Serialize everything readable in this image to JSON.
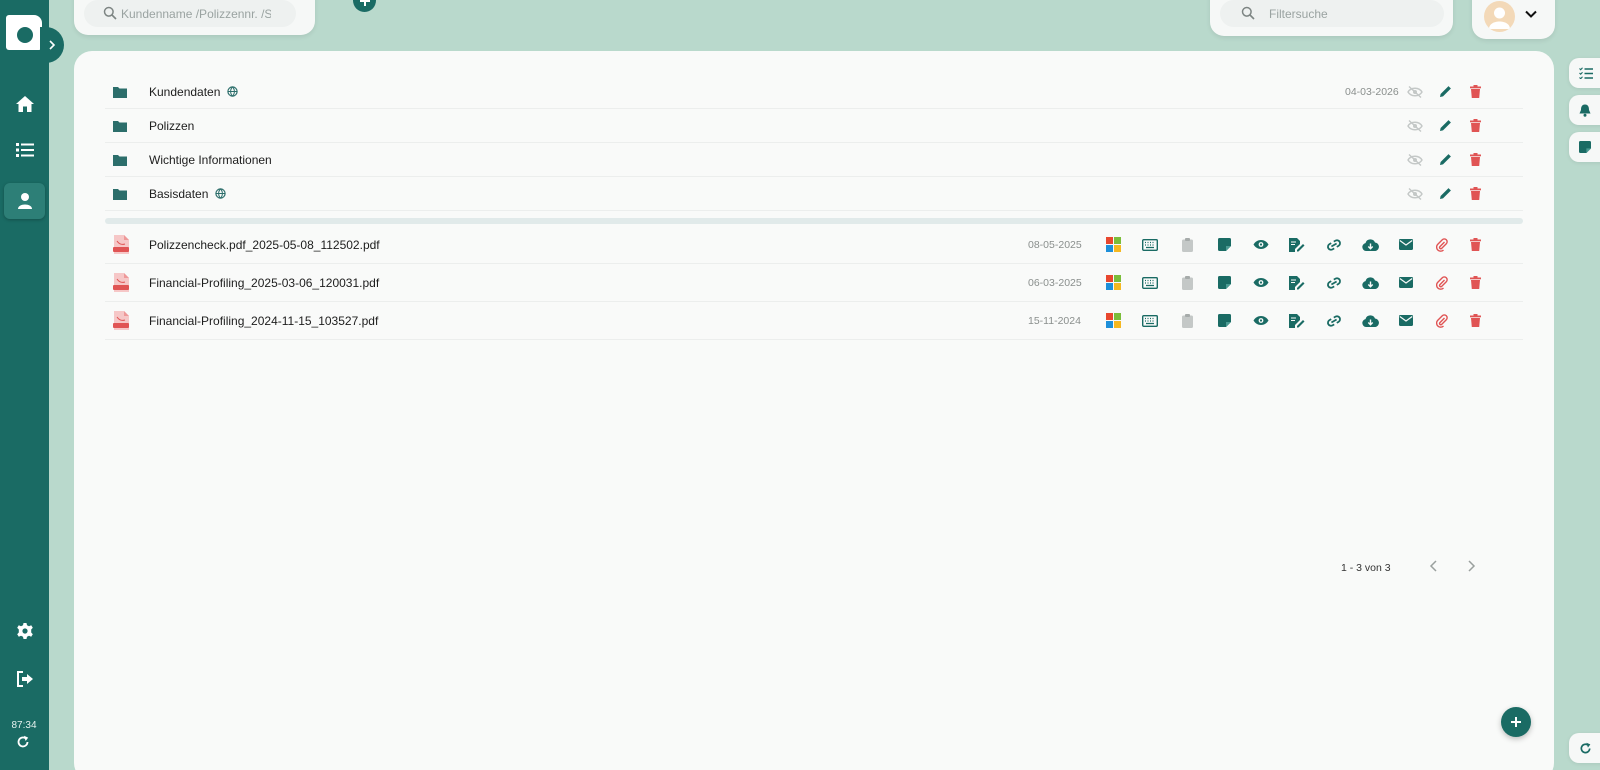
{
  "sidebar": {
    "time_label": "87:34",
    "items": [
      {
        "name": "home-icon"
      },
      {
        "name": "list-icon"
      },
      {
        "name": "person-icon",
        "active": true
      },
      {
        "name": "gear-icon"
      },
      {
        "name": "logout-icon"
      }
    ]
  },
  "top": {
    "search_placeholder": "Kundenname /Polizzennr. /Schadennr.",
    "filter_placeholder": "Filtersuche"
  },
  "folders": [
    {
      "name": "Kundendaten",
      "globe": true,
      "date": "04-03-2026"
    },
    {
      "name": "Polizzen",
      "globe": false,
      "date": ""
    },
    {
      "name": "Wichtige Informationen",
      "globe": false,
      "date": ""
    },
    {
      "name": "Basisdaten",
      "globe": true,
      "date": ""
    }
  ],
  "files": [
    {
      "name": "Polizzencheck.pdf_2025-05-08_112502.pdf",
      "date": "08-05-2025"
    },
    {
      "name": "Financial-Profiling_2025-03-06_120031.pdf",
      "date": "06-03-2025"
    },
    {
      "name": "Financial-Profiling_2024-11-15_103527.pdf",
      "date": "15-11-2024"
    }
  ],
  "pagination": {
    "text": "1 - 3 von 3"
  },
  "colors": {
    "primary": "#1a6b64",
    "background": "#b9d9cc",
    "danger": "#e05454",
    "muted": "#c4c8c7"
  }
}
